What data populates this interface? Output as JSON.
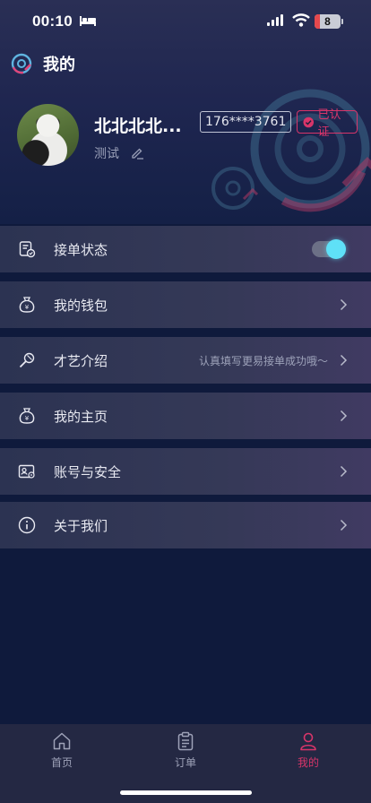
{
  "status_bar": {
    "time": "00:10",
    "battery": "8",
    "icons": [
      "bed-icon",
      "signal-icon",
      "wifi-icon",
      "battery-icon"
    ]
  },
  "header": {
    "title": "我的",
    "logo_icon": "vinyl-disc-icon"
  },
  "profile": {
    "name": "北北北北...",
    "subtitle": "测试",
    "phone": "176****3761",
    "verified_label": "已认证",
    "avatar_icon": "panda-avatar"
  },
  "menu": {
    "items": [
      {
        "label": "接单状态",
        "icon": "order-status-icon",
        "control": "toggle",
        "toggle_on": true
      },
      {
        "label": "我的钱包",
        "icon": "wallet-icon",
        "control": "chevron"
      },
      {
        "label": "才艺介绍",
        "icon": "microphone-icon",
        "hint": "认真填写更易接单成功哦～",
        "control": "chevron"
      },
      {
        "label": "我的主页",
        "icon": "money-bag-icon",
        "control": "chevron"
      },
      {
        "label": "账号与安全",
        "icon": "id-card-icon",
        "control": "chevron"
      },
      {
        "label": "关于我们",
        "icon": "info-icon",
        "control": "chevron"
      }
    ]
  },
  "tabbar": {
    "tabs": [
      {
        "label": "首页",
        "icon": "home-icon",
        "active": false
      },
      {
        "label": "订单",
        "icon": "clipboard-icon",
        "active": false
      },
      {
        "label": "我的",
        "icon": "user-icon",
        "active": true
      }
    ]
  },
  "colors": {
    "accent": "#d8356a",
    "toggle_knob": "#5fe0f7",
    "background": "#0f1a3c"
  }
}
